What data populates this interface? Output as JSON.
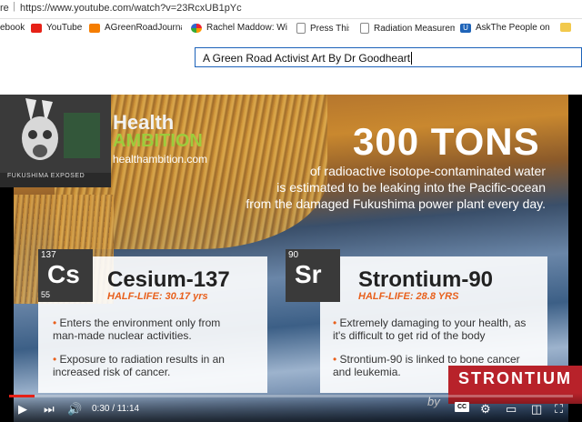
{
  "browser": {
    "left_label": "re",
    "url": "https://www.youtube.com/watch?v=23RcxUB1pYc"
  },
  "bookmarks": [
    {
      "label": "ebook",
      "icon": "bookmark-icon"
    },
    {
      "label": "YouTube",
      "icon": "youtube-icon"
    },
    {
      "label": "AGreenRoadJournal",
      "icon": "blogger-icon"
    },
    {
      "label": "Rachel Maddow: Wi",
      "icon": "nbc-icon"
    },
    {
      "label": "Press This",
      "icon": "document-icon"
    },
    {
      "label": "Radiation Measurem",
      "icon": "document-icon"
    },
    {
      "label": "AskThe People on U",
      "icon": "u-icon"
    }
  ],
  "search": {
    "value": "A Green Road Activist Art By Dr Goodheart"
  },
  "video": {
    "logo_caption": "FUKUSHIMA EXPOSED",
    "brand_health": "Health",
    "brand_ambition": "AMBITION",
    "brand_url": "healthambition.com",
    "headline": "300 TONS",
    "subline_1": "of radioactive isotope-contaminated water",
    "subline_2": "is estimated to be leaking into the Pacific-ocean",
    "subline_3": "from the damaged Fukushima power plant every day.",
    "cesium": {
      "number_top": "137",
      "symbol": "Cs",
      "number_bottom": "55",
      "name": "Cesium-137",
      "half_life": "HALF-LIFE: 30.17 yrs",
      "bullet_1": "Enters the environment only from man-made nuclear activities.",
      "bullet_2": "Exposure to radiation results in an increased risk of cancer."
    },
    "strontium": {
      "number_top": "90",
      "symbol": "Sr",
      "name": "Strontium-90",
      "half_life": "HALF-LIFE: 28.8 YRS",
      "bullet_1": "Extremely damaging to your health, as it's difficult to get rid of the body",
      "bullet_2": "Strontium-90 is linked to bone cancer and leukemia."
    },
    "overlay_thumb": "STRONTIUM",
    "overlay_by": "by"
  },
  "player": {
    "time": "0:30 / 11:14",
    "progress": 0.045,
    "cc_label": "CC"
  },
  "colors": {
    "accent_red": "#e62117",
    "half_life_orange": "#e8601c",
    "ambition_green": "#9ccc3c"
  }
}
